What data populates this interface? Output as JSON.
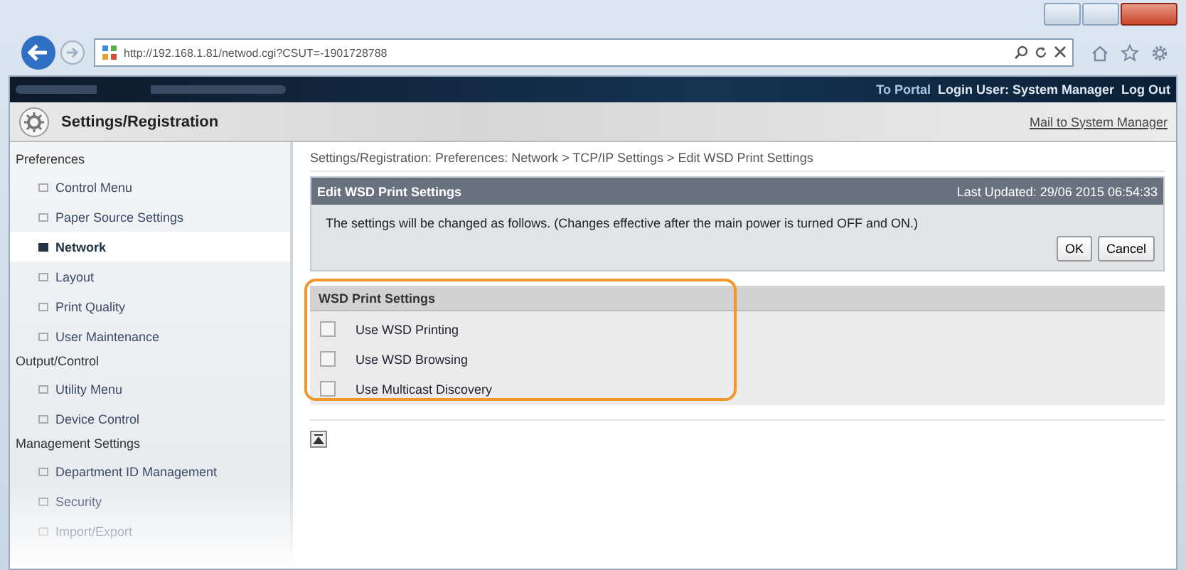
{
  "browser": {
    "address": "http://192.168.1.81/netwod.cgi?CSUT=-1901728788"
  },
  "topbar": {
    "links": [
      "To Portal",
      "Login User: System Manager",
      "Log Out"
    ]
  },
  "header": {
    "title": "Settings/Registration",
    "mail_link": "Mail to System Manager"
  },
  "sidebar": {
    "sections": [
      {
        "label": "Preferences",
        "items": [
          {
            "label": "Control Menu",
            "selected": false
          },
          {
            "label": "Paper Source Settings",
            "selected": false
          },
          {
            "label": "Network",
            "selected": true
          },
          {
            "label": "Layout",
            "selected": false
          },
          {
            "label": "Print Quality",
            "selected": false
          },
          {
            "label": "User Maintenance",
            "selected": false
          }
        ]
      },
      {
        "label": "Output/Control",
        "items": [
          {
            "label": "Utility Menu",
            "selected": false
          },
          {
            "label": "Device Control",
            "selected": false
          }
        ]
      },
      {
        "label": "Management Settings",
        "items": [
          {
            "label": "Department ID Management",
            "selected": false
          },
          {
            "label": "Security",
            "selected": false
          },
          {
            "label": "Import/Export",
            "selected": false
          }
        ]
      }
    ]
  },
  "breadcrumb": "Settings/Registration: Preferences: Network > TCP/IP Settings > Edit WSD Print Settings",
  "panel": {
    "title": "Edit WSD Print Settings",
    "updated": "Last Updated: 29/06 2015 06:54:33",
    "message": "The settings will be changed as follows. (Changes effective after the main power is turned OFF and ON.)",
    "buttons": [
      "OK",
      "Cancel"
    ]
  },
  "settings": {
    "title": "WSD Print Settings",
    "options": [
      {
        "label": "Use WSD Printing",
        "checked": false
      },
      {
        "label": "Use WSD Browsing",
        "checked": false
      },
      {
        "label": "Use Multicast Discovery",
        "checked": false
      }
    ]
  }
}
